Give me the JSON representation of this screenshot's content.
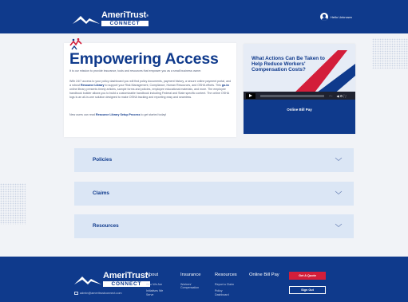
{
  "brand": {
    "name": "AmeriTrust",
    "trademark": "®",
    "sub": "CONNECT"
  },
  "header": {
    "user_label": "Hello Unknown"
  },
  "hero": {
    "title": "Empowering Access",
    "intro": "It is our mission to provide insurance, tools and resources that empower you as a small business owner.",
    "body_1": "With 24/7 access to your policy dashboard you will find policy documents, payment history, a secure online payment portal, and a robust ",
    "body_link": "Resource Library",
    "body_2": " to support your Risk Management, Compliance, Human Resources, and OSHA efforts. This ",
    "body_goto": "go-to",
    "body_3": " online library presents timely articles, sample forms and policies, employee educational materials, and more. The employee handbook builder allows you to build a customizable handbook including Federal and State specific content. The online OSHA logs is an all-in-one solution designed to make OSHA tracking and reporting easy and seamless.",
    "new_1": "New users can read ",
    "new_link": "Resource Library Setup Process",
    "new_2": " to get started today!"
  },
  "video": {
    "headline": "What Actions Can Be Taken to Help Reduce Workers' Compensation Costs?",
    "time": "-:--",
    "controls": "◀ ⚙ ⛶",
    "cta": "Online Bill Pay"
  },
  "accordions": [
    {
      "label": "Policies"
    },
    {
      "label": "Claims"
    },
    {
      "label": "Resources"
    }
  ],
  "footer": {
    "email": "admin@ameritrustconnect.com",
    "columns": [
      {
        "head": "About",
        "links": [
          "Who We Are",
          "Initiatives We Serve"
        ]
      },
      {
        "head": "Insurance",
        "links": [
          "Workers' Compensation"
        ]
      },
      {
        "head": "Resources",
        "links": [
          "Report a Claim",
          "Policy Dashboard"
        ]
      },
      {
        "head": "Online Bill Pay",
        "links": []
      }
    ],
    "quote_button": "Get A Quote",
    "signout_button": "Sign Out"
  },
  "colors": {
    "primary": "#0f3a8c",
    "accent": "#d31e3a",
    "panel": "#dbe6f5",
    "background": "#f1f3f7"
  }
}
